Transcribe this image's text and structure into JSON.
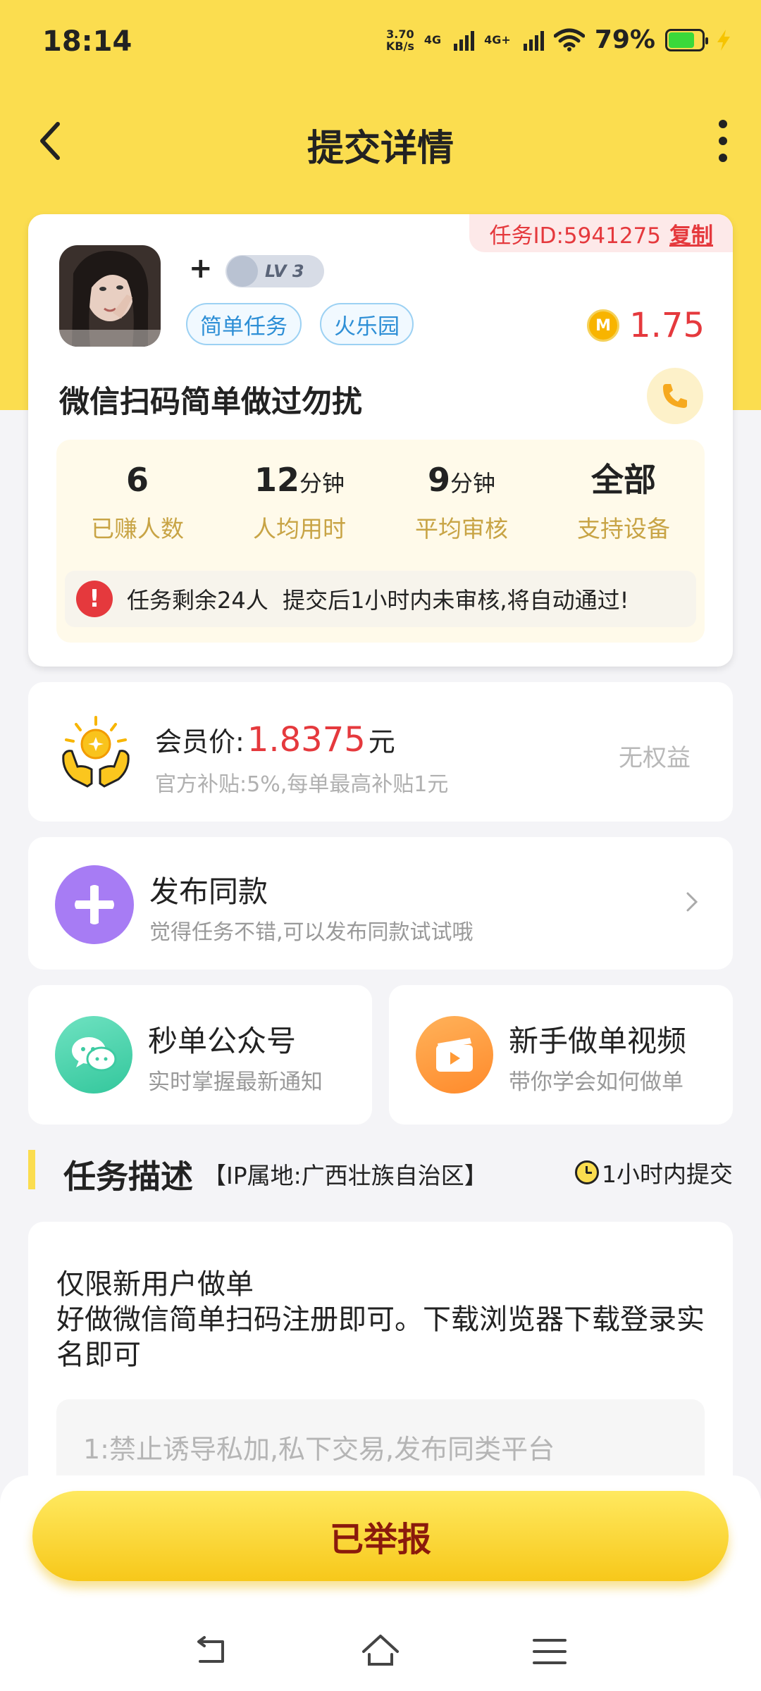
{
  "status_bar": {
    "time": "18:14",
    "speed_value": "3.70",
    "speed_unit": "KB/s",
    "net1": "4G",
    "net2": "4G+",
    "battery": "79%",
    "battery_level": 0.79
  },
  "header": {
    "title": "提交详情",
    "back_icon": "back-chevron-icon",
    "more_icon": "more-vertical-icon"
  },
  "task": {
    "id_label": "任务ID:5941275",
    "copy_label": "复制",
    "plus": "+",
    "level": "LV 3",
    "tags": [
      "简单任务",
      "火乐园"
    ],
    "coin_label": "M",
    "reward": "1.75",
    "title": "微信扫码简单做过勿扰",
    "stats": [
      {
        "value": "6",
        "unit": "",
        "label": "已赚人数"
      },
      {
        "value": "12",
        "unit": "分钟",
        "label": "人均用时"
      },
      {
        "value": "9",
        "unit": "分钟",
        "label": "平均审核"
      },
      {
        "value": "全部",
        "unit": "",
        "label": "支持设备"
      }
    ],
    "notice_icon": "!",
    "notice": "任务剩余24人  提交后1小时内未审核,将自动通过!"
  },
  "member": {
    "label": "会员价:",
    "price": "1.8375",
    "unit": "元",
    "sub": "官方补贴:5%,每单最高补贴1元",
    "right": "无权益"
  },
  "publish": {
    "title": "发布同款",
    "sub": "觉得任务不错,可以发布同款试试哦"
  },
  "cards": [
    {
      "title": "秒单公众号",
      "sub": "实时掌握最新通知",
      "icon": "wechat-icon"
    },
    {
      "title": "新手做单视频",
      "sub": "带你学会如何做单",
      "icon": "video-icon"
    }
  ],
  "section": {
    "title": "任务描述",
    "ip": "【IP属地:广西壮族自治区】",
    "time": "1小时内提交"
  },
  "description": {
    "text": "仅限新用户做单\n好做微信简单扫码注册即可。下载浏览器下载登录实名即可",
    "rule": "1:禁止诱导私加,私下交易,发布同类平台"
  },
  "bottom": {
    "button": "已举报"
  },
  "colors": {
    "brand_yellow": "#fbdd4f",
    "price_red": "#e5393d",
    "tag_blue": "#2e8fd6",
    "stat_gold": "#c8a445"
  }
}
